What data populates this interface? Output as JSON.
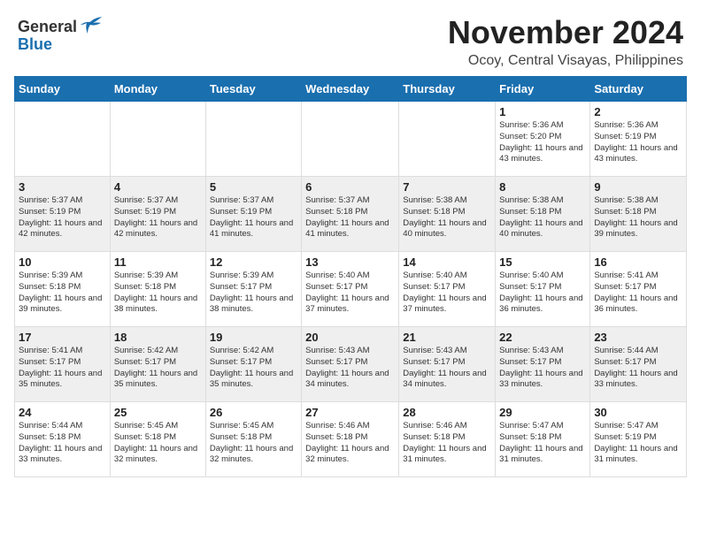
{
  "header": {
    "logo_general": "General",
    "logo_blue": "Blue",
    "month_title": "November 2024",
    "location": "Ocoy, Central Visayas, Philippines"
  },
  "weekdays": [
    "Sunday",
    "Monday",
    "Tuesday",
    "Wednesday",
    "Thursday",
    "Friday",
    "Saturday"
  ],
  "weeks": [
    [
      {
        "day": "",
        "info": ""
      },
      {
        "day": "",
        "info": ""
      },
      {
        "day": "",
        "info": ""
      },
      {
        "day": "",
        "info": ""
      },
      {
        "day": "",
        "info": ""
      },
      {
        "day": "1",
        "info": "Sunrise: 5:36 AM\nSunset: 5:20 PM\nDaylight: 11 hours and 43 minutes."
      },
      {
        "day": "2",
        "info": "Sunrise: 5:36 AM\nSunset: 5:19 PM\nDaylight: 11 hours and 43 minutes."
      }
    ],
    [
      {
        "day": "3",
        "info": "Sunrise: 5:37 AM\nSunset: 5:19 PM\nDaylight: 11 hours and 42 minutes."
      },
      {
        "day": "4",
        "info": "Sunrise: 5:37 AM\nSunset: 5:19 PM\nDaylight: 11 hours and 42 minutes."
      },
      {
        "day": "5",
        "info": "Sunrise: 5:37 AM\nSunset: 5:19 PM\nDaylight: 11 hours and 41 minutes."
      },
      {
        "day": "6",
        "info": "Sunrise: 5:37 AM\nSunset: 5:18 PM\nDaylight: 11 hours and 41 minutes."
      },
      {
        "day": "7",
        "info": "Sunrise: 5:38 AM\nSunset: 5:18 PM\nDaylight: 11 hours and 40 minutes."
      },
      {
        "day": "8",
        "info": "Sunrise: 5:38 AM\nSunset: 5:18 PM\nDaylight: 11 hours and 40 minutes."
      },
      {
        "day": "9",
        "info": "Sunrise: 5:38 AM\nSunset: 5:18 PM\nDaylight: 11 hours and 39 minutes."
      }
    ],
    [
      {
        "day": "10",
        "info": "Sunrise: 5:39 AM\nSunset: 5:18 PM\nDaylight: 11 hours and 39 minutes."
      },
      {
        "day": "11",
        "info": "Sunrise: 5:39 AM\nSunset: 5:18 PM\nDaylight: 11 hours and 38 minutes."
      },
      {
        "day": "12",
        "info": "Sunrise: 5:39 AM\nSunset: 5:17 PM\nDaylight: 11 hours and 38 minutes."
      },
      {
        "day": "13",
        "info": "Sunrise: 5:40 AM\nSunset: 5:17 PM\nDaylight: 11 hours and 37 minutes."
      },
      {
        "day": "14",
        "info": "Sunrise: 5:40 AM\nSunset: 5:17 PM\nDaylight: 11 hours and 37 minutes."
      },
      {
        "day": "15",
        "info": "Sunrise: 5:40 AM\nSunset: 5:17 PM\nDaylight: 11 hours and 36 minutes."
      },
      {
        "day": "16",
        "info": "Sunrise: 5:41 AM\nSunset: 5:17 PM\nDaylight: 11 hours and 36 minutes."
      }
    ],
    [
      {
        "day": "17",
        "info": "Sunrise: 5:41 AM\nSunset: 5:17 PM\nDaylight: 11 hours and 35 minutes."
      },
      {
        "day": "18",
        "info": "Sunrise: 5:42 AM\nSunset: 5:17 PM\nDaylight: 11 hours and 35 minutes."
      },
      {
        "day": "19",
        "info": "Sunrise: 5:42 AM\nSunset: 5:17 PM\nDaylight: 11 hours and 35 minutes."
      },
      {
        "day": "20",
        "info": "Sunrise: 5:43 AM\nSunset: 5:17 PM\nDaylight: 11 hours and 34 minutes."
      },
      {
        "day": "21",
        "info": "Sunrise: 5:43 AM\nSunset: 5:17 PM\nDaylight: 11 hours and 34 minutes."
      },
      {
        "day": "22",
        "info": "Sunrise: 5:43 AM\nSunset: 5:17 PM\nDaylight: 11 hours and 33 minutes."
      },
      {
        "day": "23",
        "info": "Sunrise: 5:44 AM\nSunset: 5:17 PM\nDaylight: 11 hours and 33 minutes."
      }
    ],
    [
      {
        "day": "24",
        "info": "Sunrise: 5:44 AM\nSunset: 5:18 PM\nDaylight: 11 hours and 33 minutes."
      },
      {
        "day": "25",
        "info": "Sunrise: 5:45 AM\nSunset: 5:18 PM\nDaylight: 11 hours and 32 minutes."
      },
      {
        "day": "26",
        "info": "Sunrise: 5:45 AM\nSunset: 5:18 PM\nDaylight: 11 hours and 32 minutes."
      },
      {
        "day": "27",
        "info": "Sunrise: 5:46 AM\nSunset: 5:18 PM\nDaylight: 11 hours and 32 minutes."
      },
      {
        "day": "28",
        "info": "Sunrise: 5:46 AM\nSunset: 5:18 PM\nDaylight: 11 hours and 31 minutes."
      },
      {
        "day": "29",
        "info": "Sunrise: 5:47 AM\nSunset: 5:18 PM\nDaylight: 11 hours and 31 minutes."
      },
      {
        "day": "30",
        "info": "Sunrise: 5:47 AM\nSunset: 5:19 PM\nDaylight: 11 hours and 31 minutes."
      }
    ]
  ]
}
